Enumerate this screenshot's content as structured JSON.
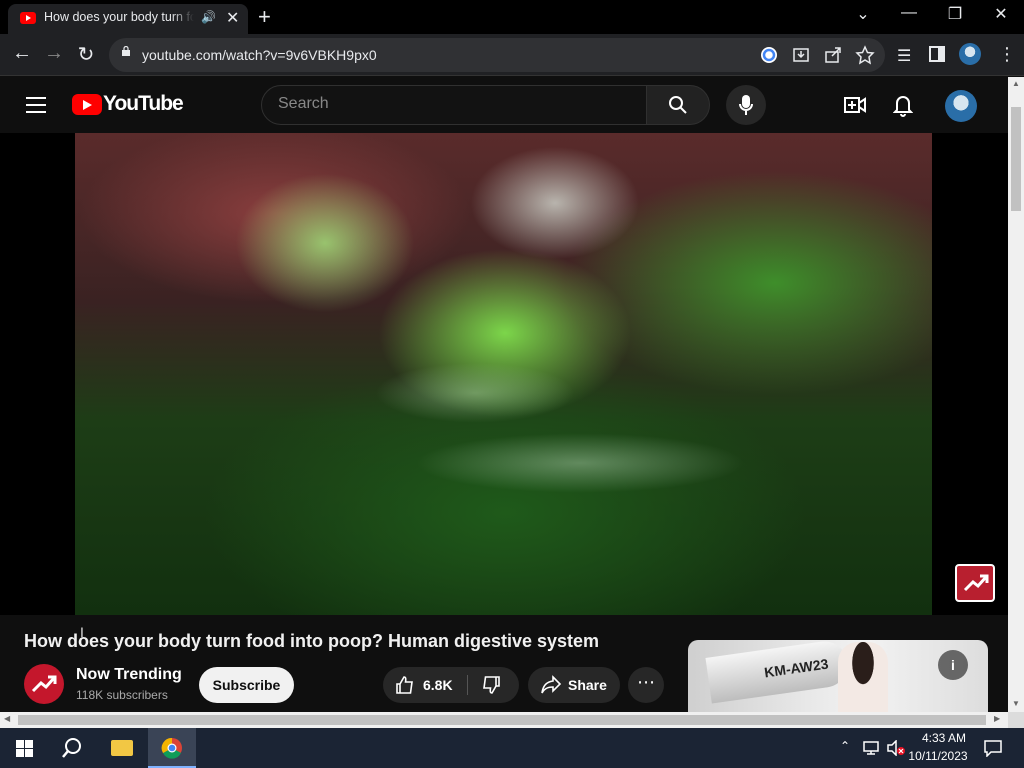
{
  "browser": {
    "tab_title": "How does your body turn food into poop? Human digestive system",
    "url": "youtube.com/watch?v=9v6VBKH9px0",
    "icons": [
      "back-icon",
      "forward-icon",
      "reload-icon",
      "lock-icon",
      "google-icon",
      "install-icon",
      "share-icon",
      "star-icon",
      "media-control-icon",
      "side-panel-icon",
      "profile-icon",
      "menu-icon"
    ]
  },
  "youtube": {
    "logo_text": "YouTube",
    "search_placeholder": "Search",
    "accent_color": "#ff0000"
  },
  "video": {
    "title": "How does your body turn food into poop? Human digestive system",
    "channel_name": "Now Trending",
    "subscribers": "118K subscribers",
    "subscribe_label": "Subscribe",
    "likes": "6.8K",
    "share_label": "Share",
    "more_label": "⋯"
  },
  "ad": {
    "plane_text": "KM-AW23",
    "info_label": "i"
  },
  "taskbar": {
    "time": "4:33 AM",
    "date": "10/11/2023"
  }
}
